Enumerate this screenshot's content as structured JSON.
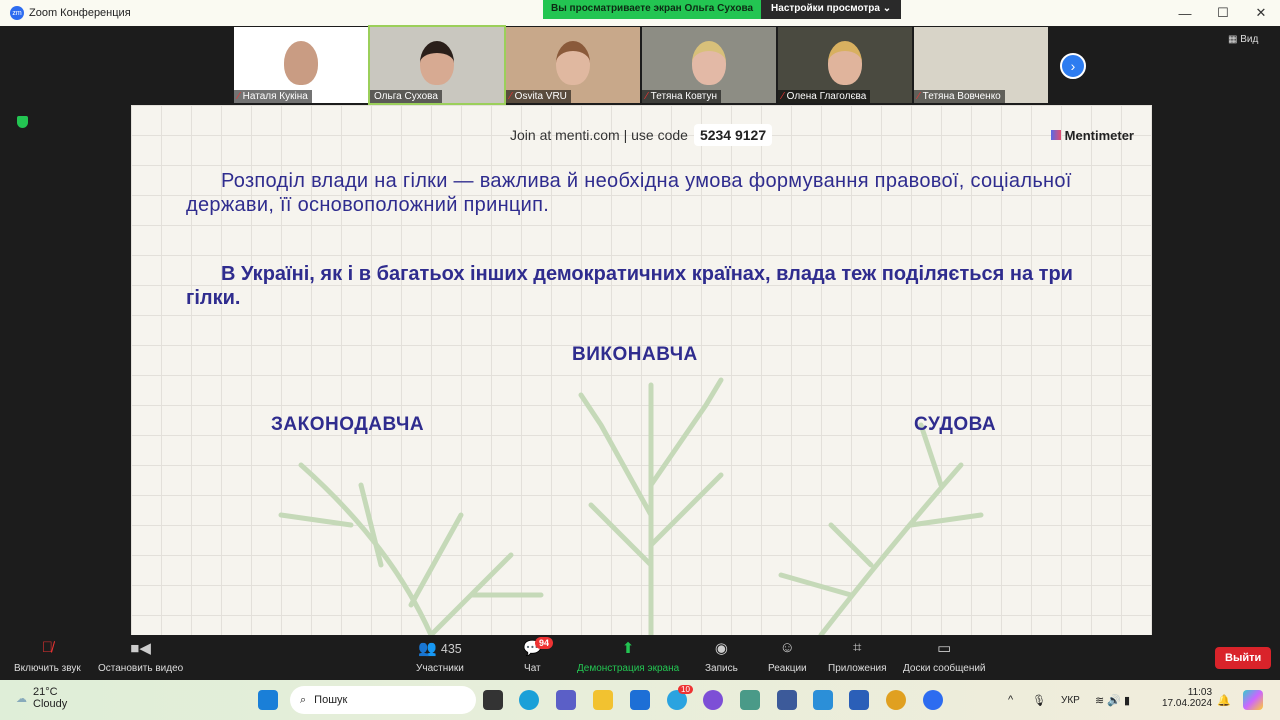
{
  "window": {
    "title": "Zoom Конференция",
    "controls": [
      "—",
      "☐",
      "✕"
    ]
  },
  "share_banner": {
    "status": "Вы просматриваете экран Ольга Сухова",
    "settings": "Настройки просмотра"
  },
  "participants": [
    {
      "name": "Наталя Кукіна",
      "muted": true
    },
    {
      "name": "Ольга Сухова",
      "muted": false
    },
    {
      "name": "Osvita VRU",
      "muted": true
    },
    {
      "name": "Тетяна Ковтун",
      "muted": true
    },
    {
      "name": "Олена Глаголєва",
      "muted": true
    },
    {
      "name": "Тетяна Вовченко",
      "muted": true
    }
  ],
  "view_label": "Вид",
  "slide": {
    "join_text": "Join at menti.com | use code",
    "code": "5234 9127",
    "brand": "Mentimeter",
    "paragraph1": "Розподіл влади на гілки — важлива й необхідна умова формування правової, соціальної держави, її основоположний принцип.",
    "paragraph2": "В Україні, як і в багатьох інших демократичних країнах, влада теж поділяється на три гілки.",
    "branches": {
      "executive": "ВИКОНАВЧА",
      "legislative": "ЗАКОНОДАВЧА",
      "judicial": "СУДОВА"
    }
  },
  "toolbar": {
    "audio": "Включить звук",
    "video": "Остановить видео",
    "participants": "Участники",
    "participants_count": "435",
    "chat": "Чат",
    "chat_badge": "94",
    "share": "Демонстрация экрана",
    "record": "Запись",
    "reactions": "Реакции",
    "apps": "Приложения",
    "whiteboards": "Доски сообщений",
    "leave": "Выйти"
  },
  "taskbar": {
    "temp": "21°C",
    "weather": "Cloudy",
    "search": "Пошук",
    "telegram_badge": "10",
    "lang": "УКР",
    "time": "11:03",
    "date": "17.04.2024"
  }
}
